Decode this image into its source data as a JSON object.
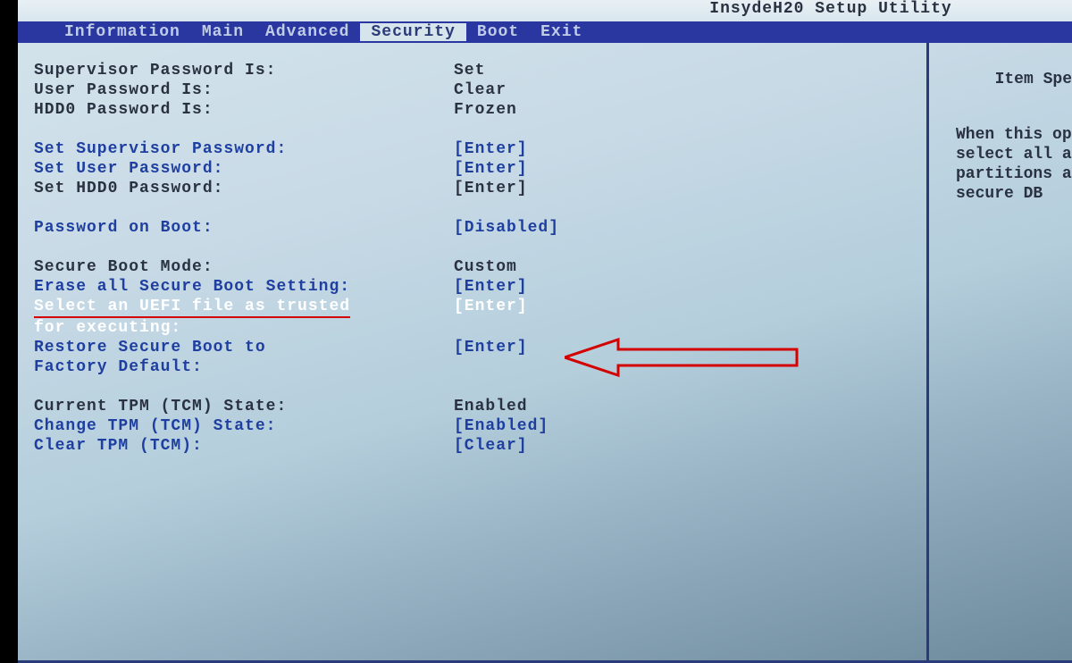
{
  "title": "InsydeH20 Setup Utility",
  "menu": {
    "items": [
      "Information",
      "Main",
      "Advanced",
      "Security",
      "Boot",
      "Exit"
    ],
    "active_index": 3
  },
  "sidebar": {
    "title": "Item Spe",
    "help": [
      "When this op",
      "select all a",
      "partitions a",
      "secure DB"
    ]
  },
  "rows": [
    {
      "label": "Supervisor Password Is:",
      "value": "Set",
      "lcls": "dark",
      "vcls": "dark",
      "interact": false
    },
    {
      "label": "User Password Is:",
      "value": "Clear",
      "lcls": "dark",
      "vcls": "dark",
      "interact": false
    },
    {
      "label": "HDD0 Password Is:",
      "value": "Frozen",
      "lcls": "dark",
      "vcls": "dark",
      "interact": false
    },
    {
      "gap": true
    },
    {
      "label": "Set Supervisor Password:",
      "value": "[Enter]",
      "lcls": "blue",
      "vcls": "blue",
      "interact": true
    },
    {
      "label": "Set User Password:",
      "value": "[Enter]",
      "lcls": "blue",
      "vcls": "blue",
      "interact": true
    },
    {
      "label": "Set HDD0 Password:",
      "value": "[Enter]",
      "lcls": "dark",
      "vcls": "dark",
      "interact": true
    },
    {
      "gap": true
    },
    {
      "label": "Password on Boot:",
      "value": "[Disabled]",
      "lcls": "blue",
      "vcls": "blue",
      "interact": true
    },
    {
      "gap": true
    },
    {
      "label": "Secure Boot Mode:",
      "value": "Custom",
      "lcls": "dark",
      "vcls": "dark",
      "interact": true
    },
    {
      "label": "Erase all Secure Boot Setting:",
      "value": "[Enter]",
      "lcls": "blue",
      "vcls": "blue",
      "interact": true
    },
    {
      "label": "Select an UEFI file as trusted",
      "value": "[Enter]",
      "lcls": "white",
      "vcls": "white",
      "interact": true,
      "selected": true,
      "underline": true
    },
    {
      "label": "for executing:",
      "value": "",
      "lcls": "white",
      "vcls": "white",
      "interact": true,
      "selected": true
    },
    {
      "label": "Restore Secure Boot to",
      "value": "[Enter]",
      "lcls": "blue",
      "vcls": "blue",
      "interact": true
    },
    {
      "label": "Factory Default:",
      "value": "",
      "lcls": "blue",
      "vcls": "blue",
      "interact": true
    },
    {
      "gap": true
    },
    {
      "label": "Current TPM (TCM) State:",
      "value": "Enabled",
      "lcls": "dark",
      "vcls": "dark",
      "interact": false
    },
    {
      "label": "Change TPM (TCM) State:",
      "value": "[Enabled]",
      "lcls": "blue",
      "vcls": "blue",
      "interact": true
    },
    {
      "label": "Clear TPM (TCM):",
      "value": "[Clear]",
      "lcls": "blue",
      "vcls": "blue",
      "interact": true
    }
  ]
}
